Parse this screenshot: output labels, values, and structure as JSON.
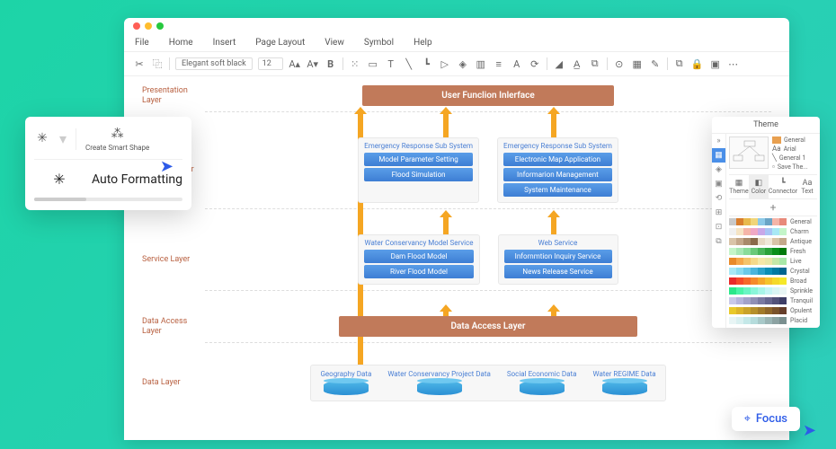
{
  "menu": {
    "file": "File",
    "home": "Home",
    "insert": "Insert",
    "pageLayout": "Page Layout",
    "view": "View",
    "symbol": "Symbol",
    "help": "Help"
  },
  "toolbar": {
    "fontName": "Elegant soft black",
    "fontSize": "12"
  },
  "layers": {
    "presentation": {
      "label": "Presentation Layer",
      "box": "User Funclion Inlerface"
    },
    "business": {
      "label": "Business layer",
      "left": {
        "title": "Emergency Response  Sub System",
        "items": [
          "Model Parameter Setting",
          "Flood Simulation"
        ]
      },
      "right": {
        "title": "Emergency Response  Sub System",
        "items": [
          "Electronic Map Application",
          "Informarion Management",
          "System Maintenance"
        ]
      }
    },
    "service": {
      "label": "Service Layer",
      "left": {
        "title": "Water Conservancy Model Service",
        "items": [
          "Dam Flood Model",
          "River Flood Model"
        ]
      },
      "right": {
        "title": "Web Service",
        "items": [
          "Infornmtion Inquiry Service",
          "News Release Service"
        ]
      }
    },
    "dataAccess": {
      "label": "Data Access Layer",
      "box": "Data Access Layer"
    },
    "data": {
      "label": "Data Layer",
      "cylinders": [
        "Geography Data",
        "Water Conservancy Project Data",
        "Social Economic Data",
        "Water REGIME Data"
      ]
    }
  },
  "popup": {
    "createSmart": "Create Smart Shape",
    "autoFmt": "Auto Formatting"
  },
  "theme": {
    "title": "Theme",
    "opts": [
      "General",
      "Arial",
      "General 1",
      "Save The..."
    ],
    "tabs": [
      "Theme",
      "Color",
      "Connector",
      "Text"
    ],
    "swatchLabels": [
      "General",
      "Charm",
      "Antique",
      "Fresh",
      "Live",
      "Crystal",
      "Broad",
      "Sprinkle",
      "Tranquil",
      "Opulent",
      "Placid"
    ]
  },
  "focus": {
    "label": "Focus"
  }
}
